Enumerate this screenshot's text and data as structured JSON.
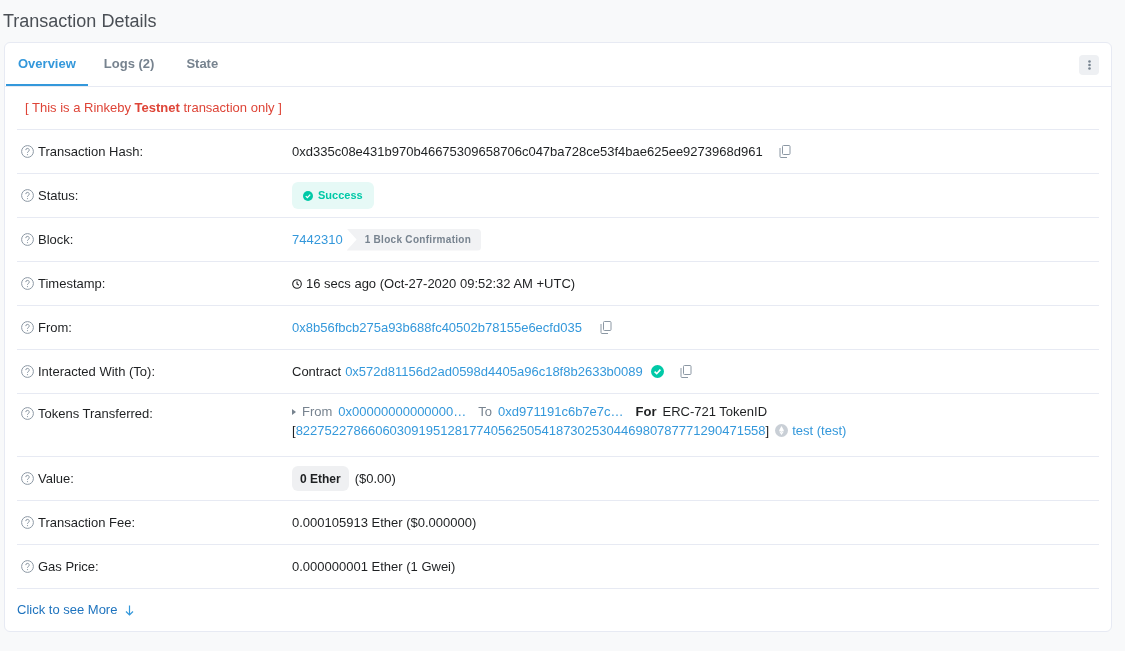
{
  "page_title": "Transaction Details",
  "tabs": [
    {
      "label": "Overview",
      "selected": true
    },
    {
      "label": "Logs (2)",
      "selected": false
    },
    {
      "label": "State",
      "selected": false
    }
  ],
  "notice": "[ This is a Rinkeby **Testnet** transaction only ]",
  "rows": [
    {
      "kind": "hash",
      "label": "Transaction Hash:",
      "value": "0xd335c08e431b970b46675309658706c047ba728ce53f4bae625ee9273968d961"
    },
    {
      "kind": "status",
      "label": "Status:",
      "badge": "Success"
    },
    {
      "kind": "block",
      "label": "Block:",
      "link": "7442310",
      "confirmations": "1 Block Confirmation"
    },
    {
      "kind": "timestamp",
      "label": "Timestamp:",
      "value": "16 secs ago (Oct-27-2020 09:52:32 AM +UTC)"
    },
    {
      "kind": "address",
      "label": "From:",
      "link": "0x8b56fbcb275a93b688fc40502b78155e6ecfd035"
    },
    {
      "kind": "contract",
      "label": "Interacted With (To):",
      "prefix": "Contract",
      "link": "0x572d81156d2ad0598d4405a96c18f8b2633b0089",
      "verified": true
    },
    {
      "kind": "tokens",
      "label": "Tokens Transferred:",
      "from_label": "From",
      "from": "0x00000000000000…",
      "to_label": "To",
      "to": "0xd971191c6b7e7c…",
      "for_label": "For",
      "token_type": "ERC-721 TokenID",
      "bracket_open": "[",
      "token_id": "82275227866060309195128177405625054187302530446980787771290471558",
      "bracket_close": "]",
      "token_name": "test (test)"
    },
    {
      "kind": "value",
      "label": "Value:",
      "amount": "0 Ether",
      "usd": "($0.00)"
    },
    {
      "kind": "text",
      "label": "Transaction Fee:",
      "value": "0.000105913 Ether ($0.000000)"
    },
    {
      "kind": "text",
      "label": "Gas Price:",
      "value": "0.000000001 Ether (1 Gwei)"
    }
  ],
  "more_link": "Click to see More"
}
